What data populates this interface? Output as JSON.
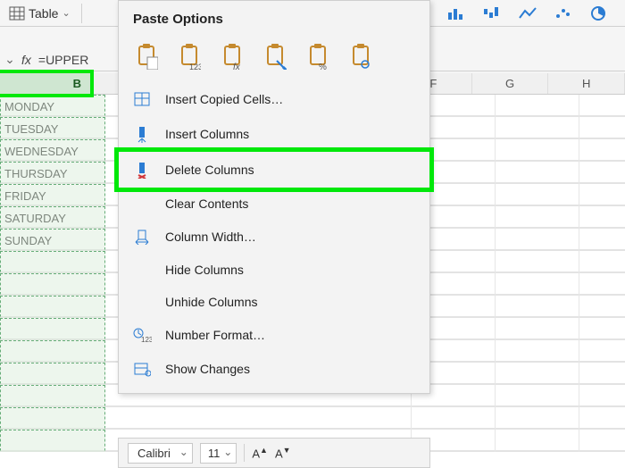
{
  "ribbon": {
    "table_label": "Table"
  },
  "formula": {
    "fx_label": "fx",
    "value": "=UPPER"
  },
  "columns": {
    "B": "B",
    "F": "F",
    "G": "G",
    "H": "H"
  },
  "data_rows": [
    "MONDAY",
    "TUESDAY",
    "WEDNESDAY",
    "THURSDAY",
    "FRIDAY",
    "SATURDAY",
    "SUNDAY"
  ],
  "menu": {
    "title": "Paste Options",
    "items": {
      "insert_copied": "Insert Copied Cells…",
      "insert_cols": "Insert Columns",
      "delete_cols": "Delete Columns",
      "clear": "Clear Contents",
      "col_width": "Column Width…",
      "hide": "Hide Columns",
      "unhide": "Unhide Columns",
      "number_format": "Number Format…",
      "show_changes": "Show Changes"
    }
  },
  "fontbar": {
    "font": "Calibri",
    "size": "11",
    "increase": "A^",
    "decrease": "A˅"
  }
}
